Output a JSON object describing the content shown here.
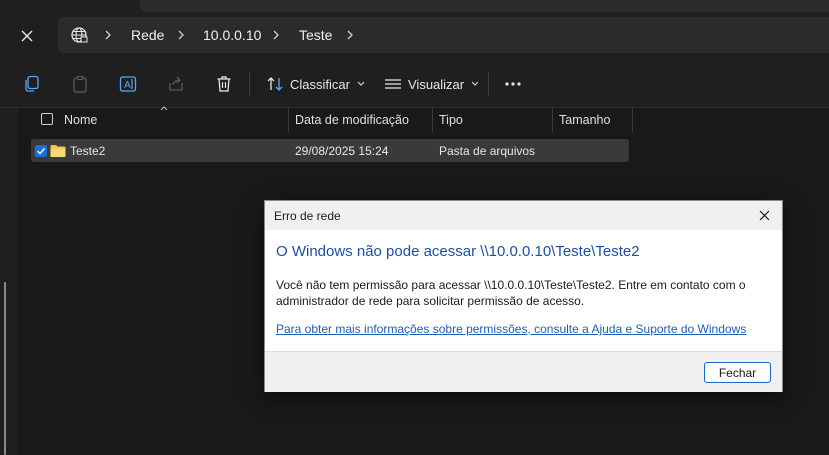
{
  "breadcrumb": {
    "items": [
      {
        "label": "Rede"
      },
      {
        "label": "10.0.0.10"
      },
      {
        "label": "Teste"
      }
    ]
  },
  "toolbar": {
    "sort_label": "Classificar",
    "view_label": "Visualizar"
  },
  "file_list": {
    "columns": [
      "Nome",
      "Data de modificação",
      "Tipo",
      "Tamanho"
    ],
    "rows": [
      {
        "name": "Teste2",
        "modified": "29/08/2025 15:24",
        "type": "Pasta de arquivos",
        "size": ""
      }
    ]
  },
  "dialog": {
    "title": "Erro de rede",
    "heading": "O Windows não pode acessar \\\\10.0.0.10\\Teste\\Teste2",
    "message": "Você não tem permissão para acessar \\\\10.0.0.10\\Teste\\Teste2. Entre em contato com o administrador de rede para solicitar permissão de acesso.",
    "link": "Para obter mais informações sobre permissões, consulte a Ajuda e Suporte do Windows",
    "button": "Fechar"
  },
  "colors": {
    "background": "#191919",
    "accent": "#1a66cc",
    "link": "#1a5fb4",
    "heading": "#1d4ea8"
  }
}
